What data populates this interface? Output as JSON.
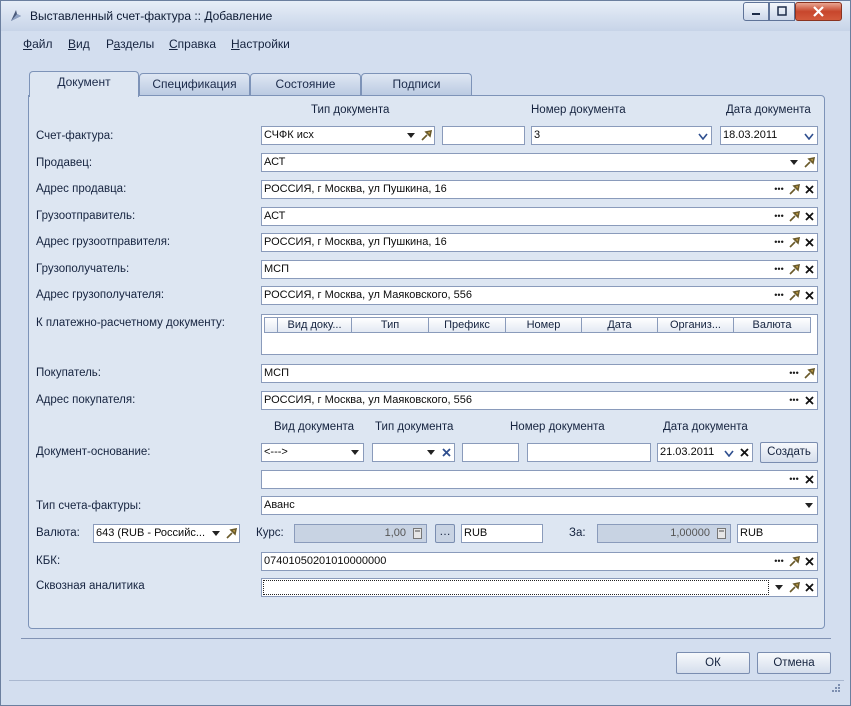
{
  "window": {
    "title": "Выставленный счет-фактура :: Добавление"
  },
  "menu": {
    "file": {
      "u": "Ф",
      "rest": "айл"
    },
    "view": {
      "u": "В",
      "rest": "ид"
    },
    "sections": {
      "pre": "Р",
      "u": "а",
      "rest": "зделы"
    },
    "help": {
      "u": "С",
      "rest": "правка"
    },
    "settings": {
      "u": "Н",
      "rest": "астройки"
    }
  },
  "tabs": [
    "Документ",
    "Спецификация",
    "Состояние",
    "Подписи"
  ],
  "headers": {
    "doc_type": "Тип документа",
    "doc_number": "Номер документа",
    "doc_date": "Дата документа"
  },
  "invoice": {
    "label": "Счет-фактура:",
    "type": "СЧФК исх",
    "prefix": "",
    "number": "3",
    "date": "18.03.2011"
  },
  "seller": {
    "label": "Продавец:",
    "value": "АСТ"
  },
  "seller_address": {
    "label": "Адрес продавца:",
    "value": "РОССИЯ, г Москва, ул Пушкина, 16"
  },
  "shipper": {
    "label": "Грузоотправитель:",
    "value": "АСТ"
  },
  "shipper_address": {
    "label": "Адрес грузоотправителя:",
    "value": "РОССИЯ, г Москва, ул Пушкина, 16"
  },
  "consignee": {
    "label": "Грузополучатель:",
    "value": "МСП"
  },
  "consignee_address": {
    "label": "Адрес грузополучателя:",
    "value": "РОССИЯ, г Москва, ул Маяковского, 556"
  },
  "payment_doc": {
    "label": "К платежно-расчетному документу:",
    "columns": [
      "Вид доку...",
      "Тип",
      "Префикс",
      "Номер",
      "Дата",
      "Организ...",
      "Валюта"
    ]
  },
  "buyer": {
    "label": "Покупатель:",
    "value": "МСП"
  },
  "buyer_address": {
    "label": "Адрес покупателя:",
    "value": "РОССИЯ, г Москва, ул Маяковского, 556"
  },
  "basis": {
    "label": "Документ-основание:",
    "h_kind": "Вид документа",
    "h_type": "Тип документа",
    "h_number": "Номер документа",
    "h_date": "Дата документа",
    "kind": "<--->",
    "type": "",
    "prefix": "",
    "number": "",
    "date": "21.03.2011",
    "create": "Создать",
    "extra": ""
  },
  "invoice_kind": {
    "label": "Тип счета-фактуры:",
    "value": "Аванс"
  },
  "currency": {
    "label": "Валюта:",
    "value": "643 (RUB - Российс...",
    "rate_label": "Курс:",
    "rate": "1,00",
    "rate_cur": "RUB",
    "per_label": "За:",
    "per": "1,00000",
    "per_cur": "RUB"
  },
  "kbk": {
    "label": "КБК:",
    "value": "07401050201010000000"
  },
  "analytics": {
    "label": "Сквозная аналитика",
    "value": ""
  },
  "buttons": {
    "ok": "ОК",
    "cancel": "Отмена"
  }
}
